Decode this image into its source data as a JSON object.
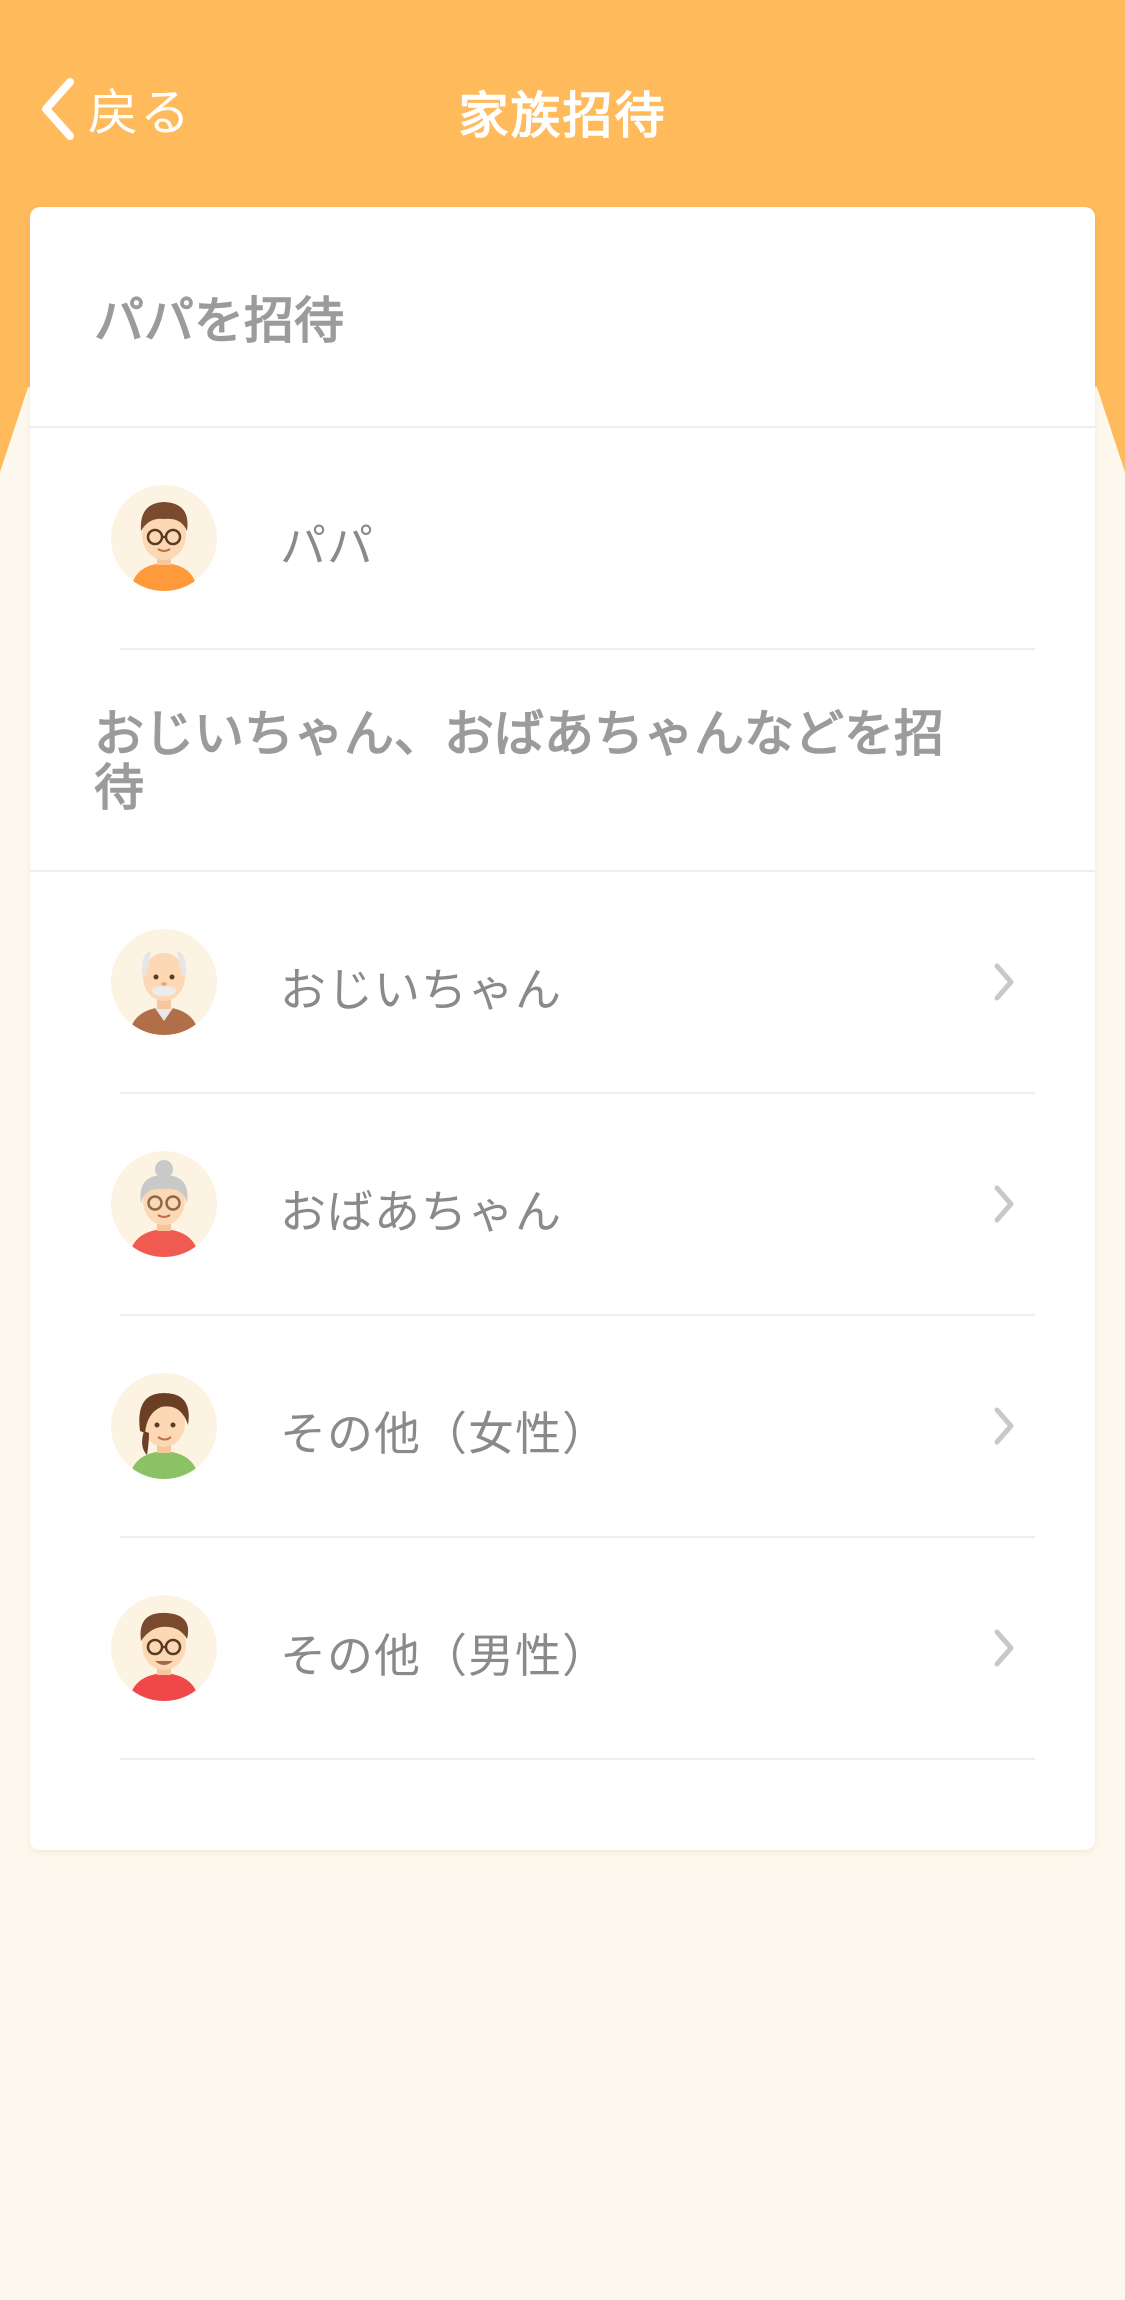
{
  "navbar": {
    "back_label": "戻る",
    "title": "家族招待"
  },
  "colors": {
    "header": "#ffba5c",
    "background": "#fdf8ed",
    "text_muted": "#9b9b9b"
  },
  "sections": [
    {
      "title": "パパを招待",
      "items": [
        {
          "label": "パパ",
          "avatar": "papa-avatar-icon",
          "has_chevron": false
        }
      ]
    },
    {
      "title": "おじいちゃん、おばあちゃんなどを招待",
      "items": [
        {
          "label": "おじいちゃん",
          "avatar": "grandpa-avatar-icon",
          "has_chevron": true
        },
        {
          "label": "おばあちゃん",
          "avatar": "grandma-avatar-icon",
          "has_chevron": true
        },
        {
          "label": "その他（女性）",
          "avatar": "other-female-avatar-icon",
          "has_chevron": true
        },
        {
          "label": "その他（男性）",
          "avatar": "other-male-avatar-icon",
          "has_chevron": true
        }
      ]
    }
  ]
}
